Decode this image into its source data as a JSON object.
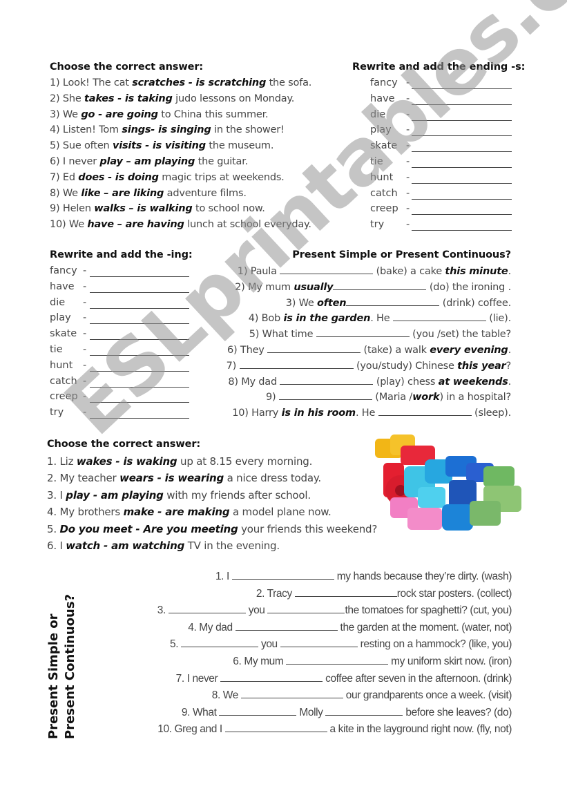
{
  "section1": {
    "title": "Choose the correct answer:",
    "items": [
      {
        "pre": "1) Look! The cat ",
        "opt": "scratches - is scratching",
        "post": " the sofa."
      },
      {
        "pre": "2) She ",
        "opt": "takes - is taking",
        "post": " judo lessons on Monday."
      },
      {
        "pre": "3) We ",
        "opt": "go - are going",
        "post": " to China this summer."
      },
      {
        "pre": "4) Listen! Tom ",
        "opt": "sings- is singing",
        "post": " in the shower!"
      },
      {
        "pre": "5) Sue often ",
        "opt": "visits - is visiting",
        "post": " the museum."
      },
      {
        "pre": "6) I never ",
        "opt": "play – am playing",
        "post": " the guitar."
      },
      {
        "pre": "7) Ed ",
        "opt": "does - is doing",
        "post": " magic trips at weekends."
      },
      {
        "pre": "8) We ",
        "opt": "like – are liking",
        "post": " adventure films."
      },
      {
        "pre": "9) Helen ",
        "opt": "walks – is walking",
        "post": " to school now."
      },
      {
        "pre": "10)  We ",
        "opt": "have – are having",
        "post": " lunch at school everyday."
      }
    ]
  },
  "section2": {
    "title": "Rewrite and add the ending -s:",
    "words": [
      "fancy",
      "have",
      "die",
      "play",
      "skate",
      "tie",
      "hunt",
      "catch",
      "creep",
      "try"
    ],
    "separator": "-"
  },
  "section3": {
    "title": "Rewrite and add the -ing:",
    "words": [
      "fancy",
      "have",
      "die",
      "play",
      "skate",
      "tie",
      "hunt",
      "catch",
      "creep",
      "try"
    ],
    "separator": "-"
  },
  "section4": {
    "title": "Present Simple or Present Continuous?",
    "items": [
      {
        "a": "1) Paula ",
        "b": "",
        "c": " (bake) a cake ",
        "d": "this minute",
        "e": "."
      },
      {
        "a": "2) My mum ",
        "b": "usually",
        "c": " (do) the ironing .",
        "d": "",
        "e": ""
      },
      {
        "a": "3) We ",
        "b": "often",
        "c": " (drink) coffee.",
        "d": "",
        "e": ""
      },
      {
        "a": "4) Bob ",
        "b": "is in the garden",
        "b2": ". He ",
        "c": " (lie).",
        "d": "",
        "e": ""
      },
      {
        "a": "5) What time ",
        "b": "",
        "c": " (you /set) the table?",
        "d": "",
        "e": ""
      },
      {
        "a": "6) They ",
        "b": "",
        "c": " (take) a walk ",
        "d": "every evening",
        "e": "."
      },
      {
        "a": "7) ",
        "b": "",
        "c": " (you/study) Chinese  ",
        "d": "this year",
        "e": "?"
      },
      {
        "a": "8) My dad ",
        "b": "",
        "c": " (play) chess ",
        "d": "at weekends",
        "e": "."
      },
      {
        "a": "9) ",
        "b": "",
        "c": " (Maria /",
        "d": "work",
        "e": ") in a hospital?"
      },
      {
        "a": "10) Harry ",
        "b": "is in his room",
        "b2": ". He ",
        "c": " (sleep).",
        "d": "",
        "e": ""
      }
    ]
  },
  "section5": {
    "title": "Choose the correct answer:",
    "items": [
      {
        "pre": "1. Liz ",
        "opt": "wakes - is waking",
        "post": " up at 8.15 every morning."
      },
      {
        "pre": "2. My teacher ",
        "opt": "wears - is wearing",
        "post": " a nice dress today."
      },
      {
        "pre": "3. I ",
        "opt": "play - am playing",
        "post": " with my friends after school."
      },
      {
        "pre": "4. My brothers ",
        "opt": "make - are making",
        "post": " a model plane now."
      },
      {
        "pre": "5. ",
        "opt": "Do you meet - Are you meeting",
        "post": " your friends this weekend?"
      },
      {
        "pre": "6. I ",
        "opt": "watch - am watching",
        "post": " TV in the evening."
      }
    ],
    "image_alt": "colorful alphabet letter blocks"
  },
  "section6": {
    "title_line1": "Present Simple or",
    "title_line2": "Present Continuous?",
    "items": [
      {
        "parts": [
          "1. I ",
          "_",
          " my hands because they’re dirty. (wash)"
        ]
      },
      {
        "parts": [
          "2. Tracy ",
          "_",
          "rock star posters. (collect)"
        ]
      },
      {
        "parts": [
          "3. ",
          "_",
          " you ",
          "_",
          "the tomatoes for spaghetti? (cut, you)"
        ]
      },
      {
        "parts": [
          "4. My dad ",
          "_",
          " the garden at the moment. (water, not)"
        ]
      },
      {
        "parts": [
          "5. ",
          "_",
          " you ",
          "_",
          " resting on a hammock? (like, you)"
        ]
      },
      {
        "parts": [
          "6. My mum ",
          "_",
          " my uniform skirt now. (iron)"
        ]
      },
      {
        "parts": [
          "7. I never ",
          "_",
          " coffee after seven in the afternoon. (drink)"
        ]
      },
      {
        "parts": [
          "8. We ",
          "_",
          " our grandparents once a week. (visit)"
        ]
      },
      {
        "parts": [
          "9. What ",
          "_",
          " Molly ",
          "_",
          " before she leaves? (do)"
        ]
      },
      {
        "parts": [
          "10. Greg and I ",
          "_",
          " a kite in the layground right now. (fly, not)"
        ]
      }
    ]
  },
  "watermark": "ESLprintables.com",
  "colors": {
    "text": "#454545",
    "heading": "#111111",
    "watermark": "#969696"
  }
}
